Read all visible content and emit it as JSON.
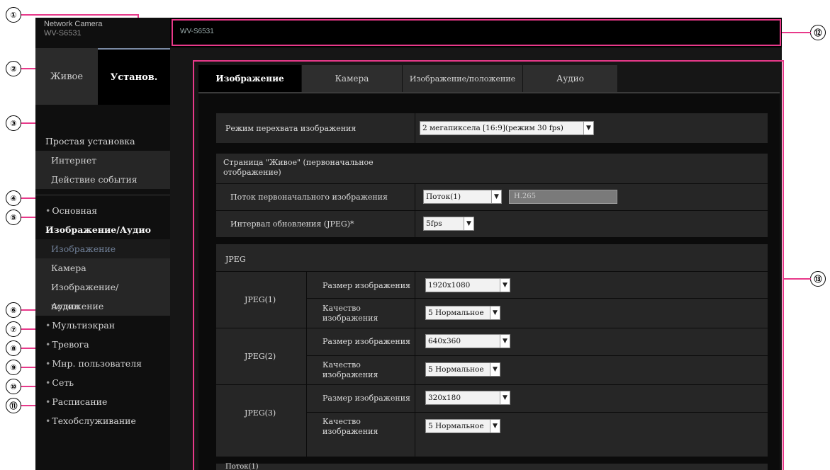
{
  "callouts": [
    "①",
    "②",
    "③",
    "④",
    "⑤",
    "⑥",
    "⑦",
    "⑧",
    "⑨",
    "⑩",
    "⑪",
    "⑫",
    "⑬"
  ],
  "logo": {
    "line1": "Network Camera",
    "line2": "WV-S6531"
  },
  "topnav": {
    "live": "Живое",
    "setup": "Установ."
  },
  "menu": {
    "easy_setup": "Простая установка",
    "easy_sub": [
      "Интернет",
      "Действие события"
    ],
    "basic": "Основная",
    "image_audio": "Изображение/Аудио",
    "image_audio_sub": [
      "Изображение",
      "Камера",
      "Изображение/положение",
      "Аудио"
    ],
    "multiscreen": "Мультиэкран",
    "alarm": "Тревога",
    "user_mng": "Мнр. пользователя",
    "network": "Сеть",
    "schedule": "Расписание",
    "maintenance": "Техобслуживание"
  },
  "topbar": {
    "title": "WV-S6531"
  },
  "tabs": [
    "Изображение",
    "Камера",
    "Изображение/положение",
    "Аудио"
  ],
  "form": {
    "capture_mode_label": "Режим перехвата изображения",
    "capture_mode_value": "2 мегапиксела [16:9](режим 30 fps)",
    "live_section": "Страница \"Живое\" (первоначальное отображение)",
    "stream_label": "Поток первоначального изображения",
    "stream_value": "Поток(1)",
    "stream_field": "H.265",
    "refresh_label": "Интервал обновления (JPEG)*",
    "refresh_value": "5fps",
    "jpeg_section": "JPEG",
    "jpeg": [
      {
        "name": "JPEG(1)",
        "size_label": "Размер изображения",
        "size": "1920x1080",
        "quality_label": "Качество изображения",
        "quality": "5 Нормальное"
      },
      {
        "name": "JPEG(2)",
        "size_label": "Размер изображения",
        "size": "640x360",
        "quality_label": "Качество изображения",
        "quality": "5 Нормальное"
      },
      {
        "name": "JPEG(3)",
        "size_label": "Размер изображения",
        "size": "320x180",
        "quality_label": "Качество изображения",
        "quality": "5 Нормальное"
      }
    ],
    "stream1_section": "Поток(1)"
  },
  "colors": {
    "accent": "#e8398a",
    "sidebar": "#0f0f0f",
    "panel": "#262626"
  }
}
